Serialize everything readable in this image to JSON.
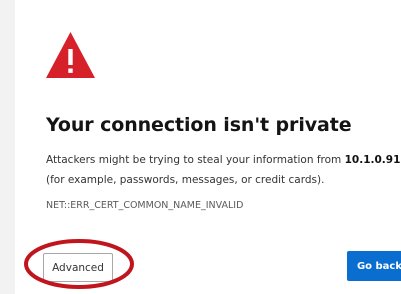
{
  "icons": {
    "warning": "warning-triangle-icon",
    "warning_color": "#d6202a",
    "warning_mark": "!"
  },
  "heading": "Your connection isn't private",
  "message": {
    "before": "Attackers might be trying to steal your information from ",
    "host": "10.1.0.91",
    "after": " (for example, passwords, messages, or credit cards)."
  },
  "error_code": "NET::ERR_CERT_COMMON_NAME_INVALID",
  "buttons": {
    "advanced": "Advanced",
    "go_back": "Go back"
  },
  "colors": {
    "primary_button": "#0a6ed1",
    "highlight_circle": "#c0151c"
  }
}
